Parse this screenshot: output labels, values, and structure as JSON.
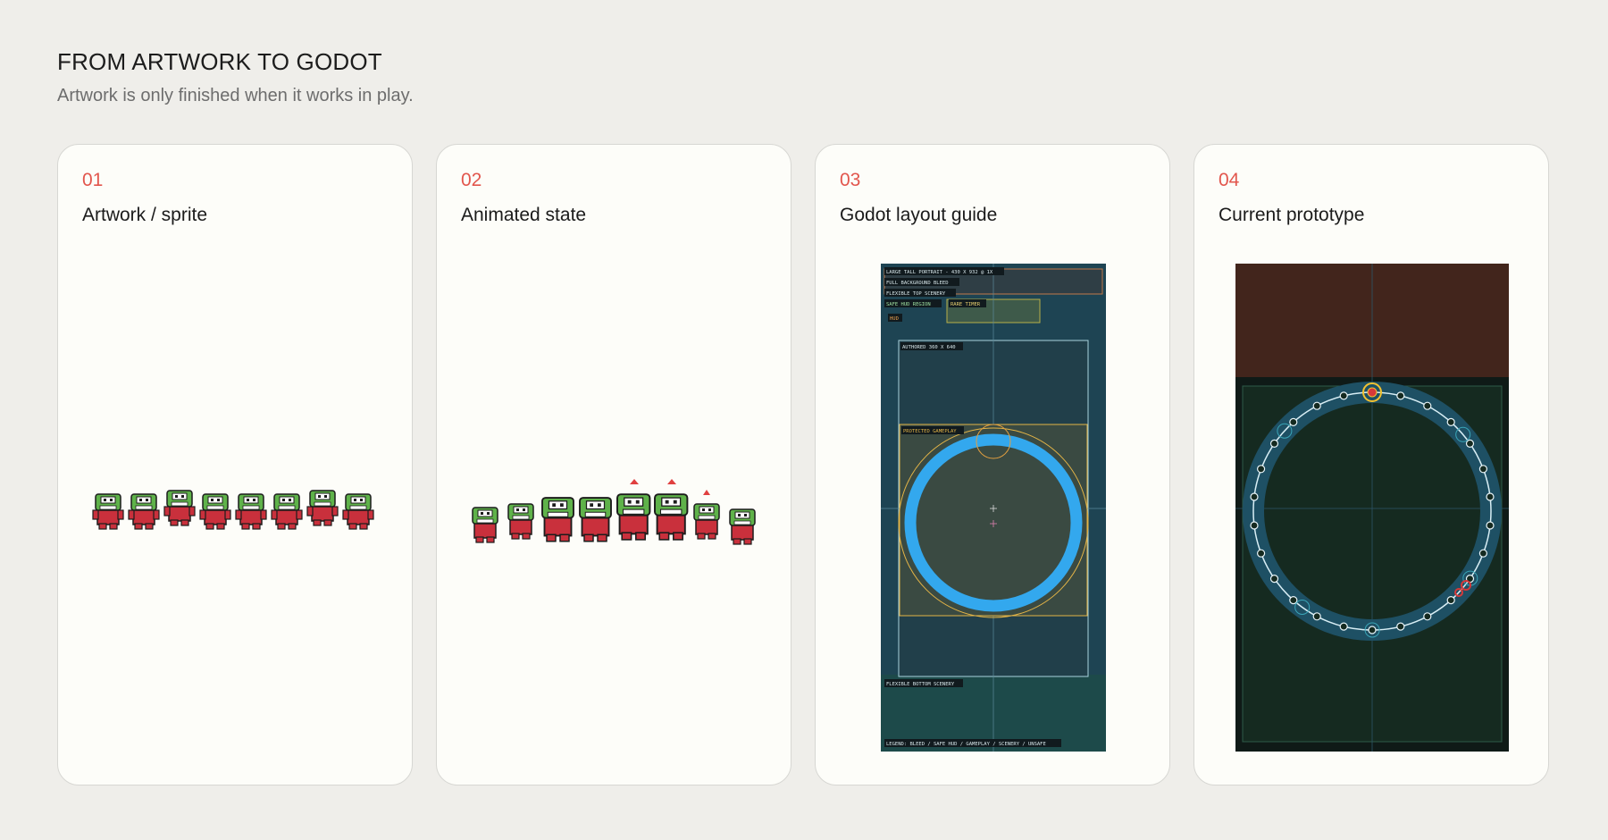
{
  "page": {
    "title": "FROM ARTWORK TO GODOT",
    "subtitle": "Artwork is only finished when it works in play."
  },
  "cards": [
    {
      "number": "01",
      "label": "Artwork / sprite"
    },
    {
      "number": "02",
      "label": "Animated state"
    },
    {
      "number": "03",
      "label": "Godot layout guide"
    },
    {
      "number": "04",
      "label": "Current prototype"
    }
  ],
  "layout_guide": {
    "labels": {
      "portrait": "LARGE TALL PORTRAIT - 430 X 932 @ 1X",
      "bleed": "FULL BACKGROUND BLEED",
      "top_scenery": "FLEXIBLE TOP SCENERY",
      "safe_hud": "SAFE HUD REGION",
      "rare_timer": "RARE TIMER",
      "hud": "HUD",
      "authored": "AUTHORED 360 X 640",
      "protected": "PROTECTED GAMEPLAY",
      "bottom_scenery": "FLEXIBLE BOTTOM SCENERY",
      "legend": "LEGEND: BLEED / SAFE HUD / GAMEPLAY / SCENERY / UNSAFE"
    },
    "colors": {
      "background": "#1e4453",
      "ring": "#33a8ee",
      "gameplay_outline": "#e3b447",
      "authored_outline": "#a9d3dd"
    }
  },
  "prototype": {
    "colors": {
      "top_band": "#42251c",
      "play_area": "#152a20",
      "ring_glow": "#1e5064",
      "ring_line": "#d8eef5",
      "marker_gold": "#f2c230",
      "marker_red": "#d6393a"
    }
  },
  "sprites": {
    "colors": {
      "skin": "#5fb24a",
      "body": "#c9303c",
      "outline": "#1c1c1c",
      "eye": "#ffffff",
      "hat": "#e04040"
    }
  }
}
